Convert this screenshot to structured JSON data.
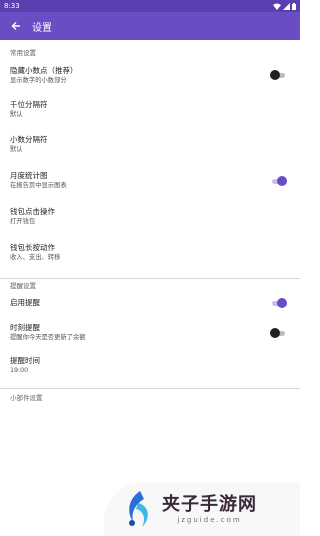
{
  "status_bar": {
    "time": "8:33"
  },
  "app_bar": {
    "title": "设置"
  },
  "sections": {
    "common": {
      "header": "常用设置",
      "hide_decimal": {
        "title": "隐藏小数点（推荐）",
        "subtitle": "显示数字的小数部分",
        "on": false
      },
      "thousands_sep": {
        "title": "千位分隔符",
        "subtitle": "默认"
      },
      "decimal_sep": {
        "title": "小数分隔符",
        "subtitle": "默认"
      },
      "monthly_chart": {
        "title": "月度统计图",
        "subtitle": "在报告页中显示图表",
        "on": true
      },
      "wallet_click": {
        "title": "钱包点击操作",
        "subtitle": "打开钱包"
      },
      "wallet_long_press": {
        "title": "钱包长按动作",
        "subtitle": "收入、支出、转移"
      }
    },
    "reminder": {
      "header": "提醒设置",
      "enable": {
        "title": "启用提醒",
        "on": true
      },
      "timed": {
        "title": "时刻提醒",
        "subtitle": "提醒你今天是否更新了余额",
        "on": false
      },
      "time": {
        "title": "提醒时间",
        "subtitle": "19:00"
      }
    },
    "widget": {
      "header": "小部件设置"
    }
  },
  "watermark": {
    "big": "夹子手游网",
    "small": "jzguide.com"
  },
  "colors": {
    "primary": "#6a4cc4",
    "status": "#5a3fb0"
  }
}
